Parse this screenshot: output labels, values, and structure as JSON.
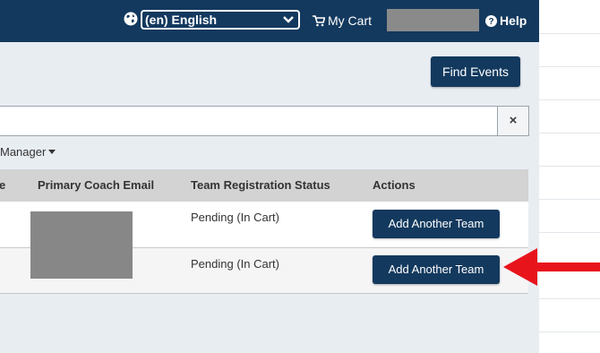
{
  "header": {
    "language": "(en) English",
    "cart_label": "My Cart",
    "help_label": "Help"
  },
  "actions": {
    "find_events_label": "Find Events"
  },
  "search": {
    "value": "",
    "clear_label": "×"
  },
  "view_menu": {
    "label": "Manager"
  },
  "table": {
    "columns": [
      "e",
      "Primary Coach Email",
      "Team Registration Status",
      "Actions"
    ],
    "rows": [
      {
        "status": "Pending (In Cart)",
        "action": "Add Another Team"
      },
      {
        "status": "Pending (In Cart)",
        "action": "Add Another Team"
      }
    ]
  },
  "colors": {
    "nav_bg": "#13395e",
    "page_bg": "#e8edf2",
    "arrow": "#e8141c"
  }
}
